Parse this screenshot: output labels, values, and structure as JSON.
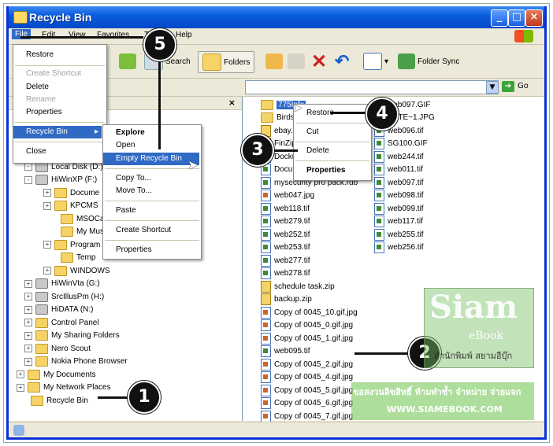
{
  "window": {
    "title": "Recycle Bin"
  },
  "menubar": {
    "file": "File",
    "edit": "Edit",
    "view": "View",
    "favorites": "Favorites",
    "tools": "Tools",
    "help": "Help"
  },
  "toolbar": {
    "search": "Search",
    "folders": "Folders",
    "folder_sync": "Folder Sync"
  },
  "address": {
    "go": "Go"
  },
  "file_menu": {
    "restore": "Restore",
    "create_shortcut": "Create Shortcut",
    "delete": "Delete",
    "rename": "Rename",
    "properties": "Properties",
    "recycle_bin": "Recycle Bin",
    "close": "Close"
  },
  "submenu": {
    "explore": "Explore",
    "open": "Open",
    "empty": "Empty Recycle Bin",
    "copy_to": "Copy To...",
    "move_to": "Move To...",
    "paste": "Paste",
    "create_shortcut": "Create Shortcut",
    "properties": "Properties"
  },
  "context_menu": {
    "restore": "Restore",
    "cut": "Cut",
    "delete": "Delete",
    "properties": "Properties"
  },
  "tree": [
    {
      "label": "Local Disk (D:)",
      "icon": "drive-icon",
      "exp": "-"
    },
    {
      "label": "HiWinXP (F:)",
      "icon": "drive-icon",
      "exp": "-"
    },
    {
      "label": "Docume",
      "icon": "folder-icon",
      "exp": "+"
    },
    {
      "label": "KPCMS",
      "icon": "folder-icon",
      "exp": "+"
    },
    {
      "label": "MSOCac",
      "icon": "folder-icon",
      "exp": ""
    },
    {
      "label": "My Mus",
      "icon": "folder-icon",
      "exp": ""
    },
    {
      "label": "Program",
      "icon": "folder-icon",
      "exp": "+"
    },
    {
      "label": "Temp",
      "icon": "folder-icon",
      "exp": ""
    },
    {
      "label": "WINDOWS",
      "icon": "folder-icon",
      "exp": "+"
    },
    {
      "label": "HiWinVta (G:)",
      "icon": "drive-icon",
      "exp": "+"
    },
    {
      "label": "SrcIllusPm (H:)",
      "icon": "cd-icon",
      "exp": "+"
    },
    {
      "label": "HiDATA (N:)",
      "icon": "drive-icon",
      "exp": "+"
    },
    {
      "label": "Control Panel",
      "icon": "control-panel-icon",
      "exp": "+"
    },
    {
      "label": "My Sharing Folders",
      "icon": "folder-icon",
      "exp": "+"
    },
    {
      "label": "Nero Scout",
      "icon": "nero-icon",
      "exp": "+"
    },
    {
      "label": "Nokia Phone Browser",
      "icon": "phone-icon",
      "exp": "+"
    },
    {
      "label": "My Documents",
      "icon": "folder-icon",
      "exp": "+"
    },
    {
      "label": "My Network Places",
      "icon": "network-icon",
      "exp": "+"
    },
    {
      "label": "Recycle Bin",
      "icon": "recycle-bin-icon",
      "exp": ""
    }
  ],
  "files_col1": [
    {
      "name": "775Info",
      "type": "folder"
    },
    {
      "name": "Birds",
      "type": "folder"
    },
    {
      "name": "ebay.zip",
      "type": "zip"
    },
    {
      "name": "FinZip",
      "type": "zip"
    },
    {
      "name": "Dockutl",
      "type": "img"
    },
    {
      "name": "Docu11",
      "type": "img"
    },
    {
      "name": "mysecurity pro pack.rdb",
      "type": "img"
    },
    {
      "name": "web047.jpg",
      "type": "jpg"
    },
    {
      "name": "web118.tif",
      "type": "img"
    },
    {
      "name": "web279.tif",
      "type": "img"
    },
    {
      "name": "web252.tif",
      "type": "img"
    },
    {
      "name": "web253.tif",
      "type": "img"
    },
    {
      "name": "web277.tif",
      "type": "img"
    },
    {
      "name": "web278.tif",
      "type": "img"
    },
    {
      "name": "schedule task.zip",
      "type": "zip"
    },
    {
      "name": "backup.zip",
      "type": "zip"
    },
    {
      "name": "Copy of 0045_10.gif.jpg",
      "type": "jpg"
    },
    {
      "name": "Copy of 0045_0.gif.jpg",
      "type": "jpg"
    },
    {
      "name": "Copy of 0045_1.gif.jpg",
      "type": "jpg"
    },
    {
      "name": "web095.tif",
      "type": "img"
    },
    {
      "name": "Copy of 0045_2.gif.jpg",
      "type": "jpg"
    },
    {
      "name": "Copy of 0045_4.gif.jpg",
      "type": "jpg"
    },
    {
      "name": "Copy of 0045_5.gif.jpg",
      "type": "jpg"
    },
    {
      "name": "Copy of 0045_6.gif.jpg",
      "type": "jpg"
    },
    {
      "name": "Copy of 0045_7.gif.jpg",
      "type": "jpg"
    }
  ],
  "files_col2": [
    {
      "name": "web097.GIF",
      "type": "img"
    },
    {
      "name": "BYTE~1.JPG",
      "type": "jpg"
    },
    {
      "name": "web096.tif",
      "type": "img"
    },
    {
      "name": "SG100.GIF",
      "type": "img"
    },
    {
      "name": "web244.tif",
      "type": "img"
    },
    {
      "name": "web011.tif",
      "type": "img"
    },
    {
      "name": "web097.tif",
      "type": "img"
    },
    {
      "name": "web098.tif",
      "type": "img"
    },
    {
      "name": "web099.tif",
      "type": "img"
    },
    {
      "name": "web117.tif",
      "type": "img"
    },
    {
      "name": "web255.tif",
      "type": "img"
    },
    {
      "name": "web256.tif",
      "type": "img"
    }
  ],
  "callouts": [
    "1",
    "2",
    "3",
    "4",
    "5"
  ],
  "watermark": {
    "big": "Siam",
    "small": "eBook",
    "sub": "สำนักพิมพ์ สยามอีบุ๊ก",
    "banner_line1": "ขอสงวนลิขสิทธิ์ ห้ามทำซ้ำ จำหน่าย จ่ายแจก",
    "banner_line2": "WWW.SIAMEBOOK.COM"
  }
}
